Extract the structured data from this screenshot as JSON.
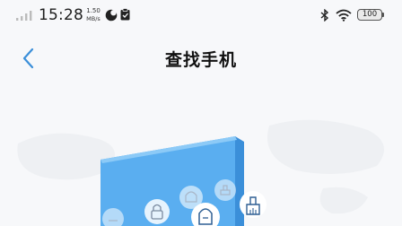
{
  "status_bar": {
    "time": "15:28",
    "speed_value": "1.50",
    "speed_unit": "MB/s",
    "battery": "100"
  },
  "header": {
    "title": "查找手机"
  },
  "icons": {
    "back": "chevron-left-icon",
    "signal": "signal-icon",
    "moon": "do-not-disturb-icon",
    "clip": "clipboard-icon",
    "bluetooth": "bluetooth-icon",
    "wifi": "wifi-icon",
    "battery": "battery-icon",
    "lock": "lock-icon",
    "ring": "ring-icon",
    "erase": "erase-icon"
  },
  "colors": {
    "accent": "#3b8fd9",
    "background": "#f7f8fa",
    "panel": "#5aaef0"
  }
}
